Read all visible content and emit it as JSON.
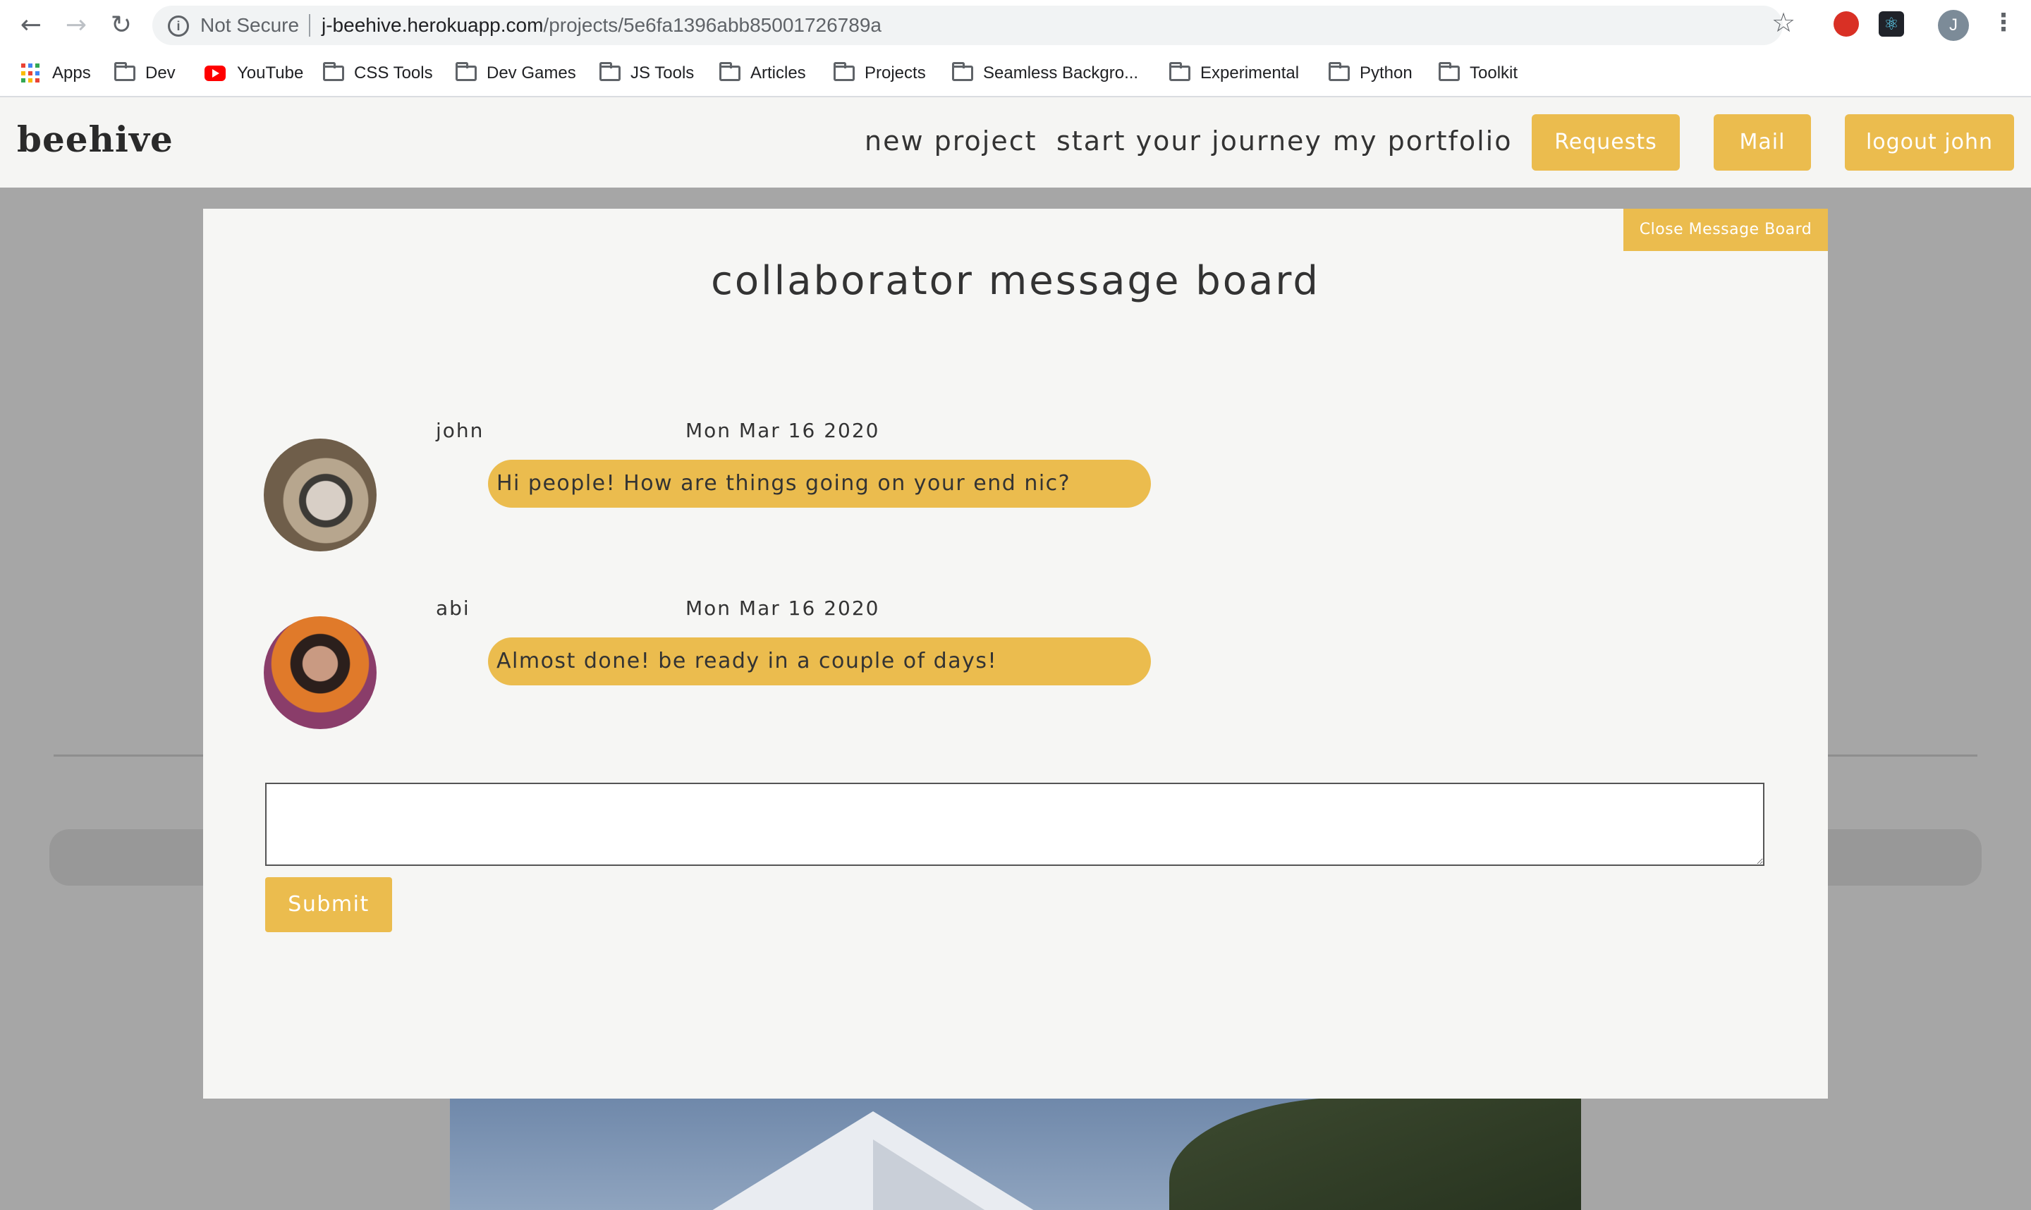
{
  "browser": {
    "security_label": "Not Secure",
    "url_host": "j-beehive.herokuapp.com",
    "url_path": "/projects/5e6fa1396abb85001726789a",
    "profile_initial": "J",
    "bookmarks": [
      {
        "label": "Apps",
        "icon": "apps-grid-icon"
      },
      {
        "label": "Dev",
        "icon": "folder-icon"
      },
      {
        "label": "YouTube",
        "icon": "youtube-icon"
      },
      {
        "label": "CSS Tools",
        "icon": "folder-icon"
      },
      {
        "label": "Dev Games",
        "icon": "folder-icon"
      },
      {
        "label": "JS Tools",
        "icon": "folder-icon"
      },
      {
        "label": "Articles",
        "icon": "folder-icon"
      },
      {
        "label": "Projects",
        "icon": "folder-icon"
      },
      {
        "label": "Seamless Backgro...",
        "icon": "folder-icon"
      },
      {
        "label": "Experimental",
        "icon": "folder-icon"
      },
      {
        "label": "Python",
        "icon": "folder-icon"
      },
      {
        "label": "Toolkit",
        "icon": "folder-icon"
      }
    ]
  },
  "site": {
    "logo": "beehive",
    "nav": {
      "new_project": "new project",
      "start_journey": "start your journey",
      "portfolio": "my portfolio",
      "requests": "Requests",
      "mail": "Mail",
      "logout": "logout john"
    },
    "accent_color": "#ebbc4e"
  },
  "modal": {
    "close_label": "Close Message Board",
    "title": "collaborator message board",
    "messages": [
      {
        "author": "john",
        "date": "Mon Mar 16 2020",
        "text": "Hi people! How are things going on your end nic?"
      },
      {
        "author": "abi",
        "date": "Mon Mar 16 2020",
        "text": "Almost done! be ready in a couple of days!"
      }
    ],
    "input_value": "",
    "submit_label": "Submit"
  }
}
